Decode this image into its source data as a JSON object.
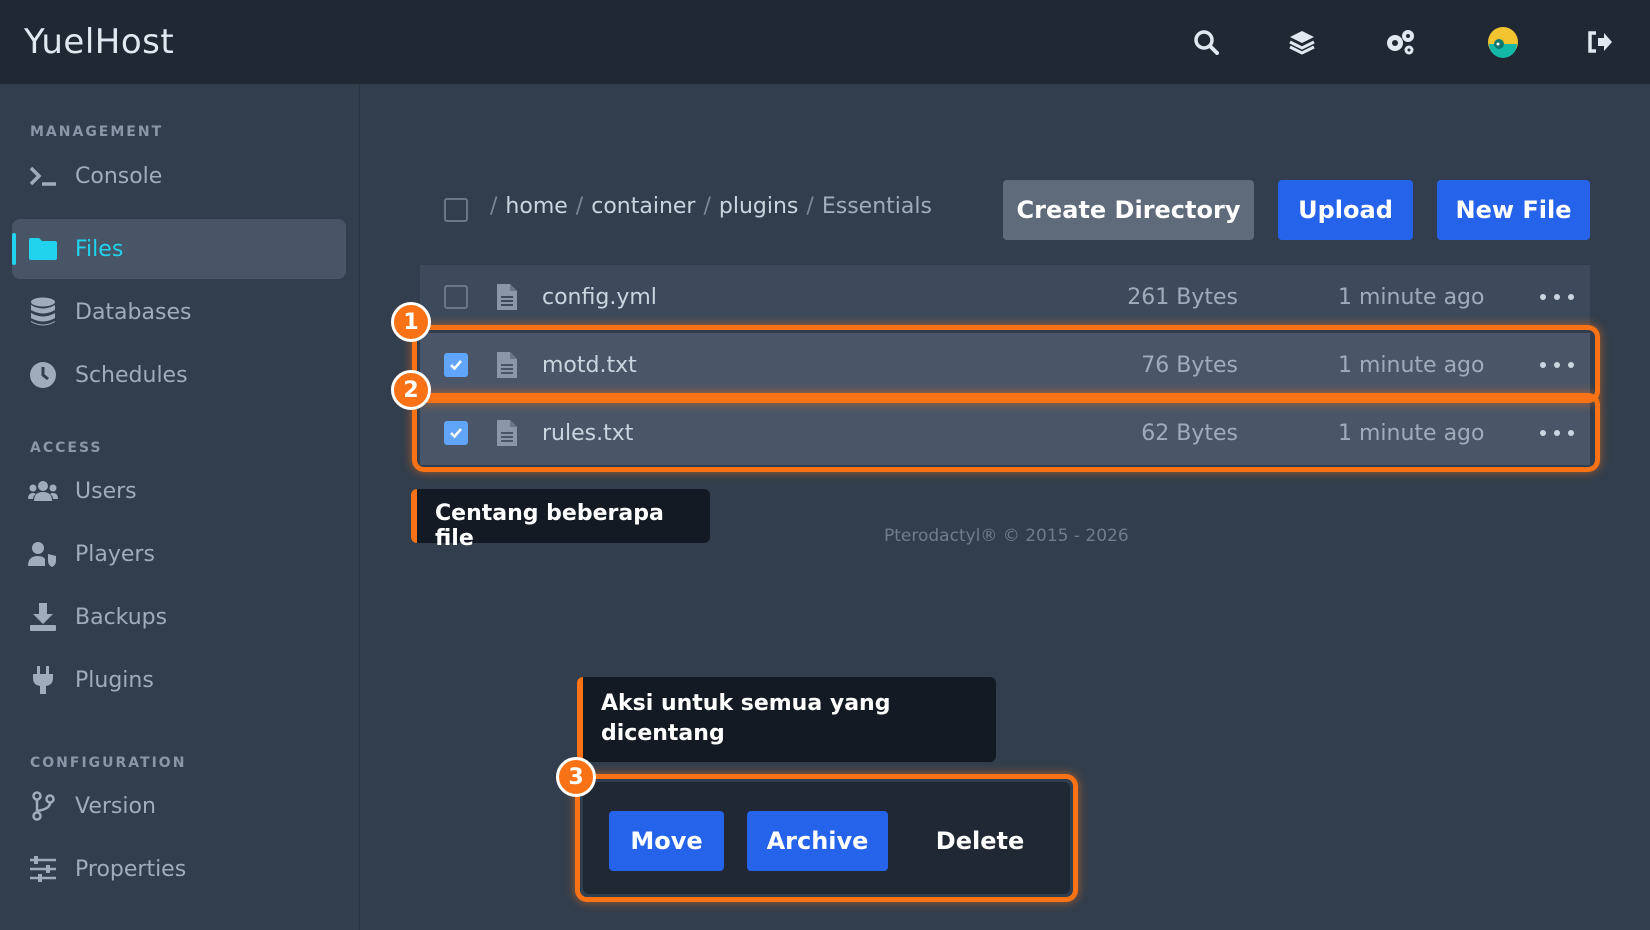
{
  "app": {
    "title": "YuelHost"
  },
  "topbar": {
    "icons": [
      "search-icon",
      "layers-icon",
      "cogs-icon",
      "avatar",
      "logout-icon"
    ]
  },
  "sidebar": {
    "sections": [
      {
        "title": "MANAGEMENT"
      },
      {
        "title": "ACCESS"
      },
      {
        "title": "CONFIGURATION"
      }
    ],
    "items": [
      {
        "label": "Console",
        "icon": "terminal-icon"
      },
      {
        "label": "Files",
        "icon": "folder-icon",
        "active": true
      },
      {
        "label": "Databases",
        "icon": "database-icon"
      },
      {
        "label": "Schedules",
        "icon": "clock-icon"
      },
      {
        "label": "Users",
        "icon": "users-icon"
      },
      {
        "label": "Players",
        "icon": "player-shield-icon"
      },
      {
        "label": "Backups",
        "icon": "download-icon"
      },
      {
        "label": "Plugins",
        "icon": "plug-icon"
      },
      {
        "label": "Version",
        "icon": "branch-icon"
      },
      {
        "label": "Properties",
        "icon": "sliders-icon"
      }
    ]
  },
  "breadcrumb": {
    "separator": "/",
    "segments": [
      "home",
      "container",
      "plugins"
    ],
    "current": "Essentials"
  },
  "toolbar": {
    "create_directory": "Create Directory",
    "upload": "Upload",
    "new_file": "New File"
  },
  "files": [
    {
      "name": "config.yml",
      "size": "261 Bytes",
      "modified": "1 minute ago",
      "checked": false
    },
    {
      "name": "motd.txt",
      "size": "76 Bytes",
      "modified": "1 minute ago",
      "checked": true
    },
    {
      "name": "rules.txt",
      "size": "62 Bytes",
      "modified": "1 minute ago",
      "checked": true
    }
  ],
  "annotations": {
    "badges": [
      "1",
      "2",
      "3"
    ],
    "tip_check": "Centang beberapa file",
    "tip_actions": "Aksi untuk semua yang dicentang"
  },
  "footer": {
    "text": "Pterodactyl® © 2015 - 2026"
  },
  "mass_actions": {
    "move": "Move",
    "archive": "Archive",
    "delete": "Delete"
  },
  "colors": {
    "accent": "#22d3ee",
    "primary": "#2563eb",
    "highlight": "#f97316"
  }
}
